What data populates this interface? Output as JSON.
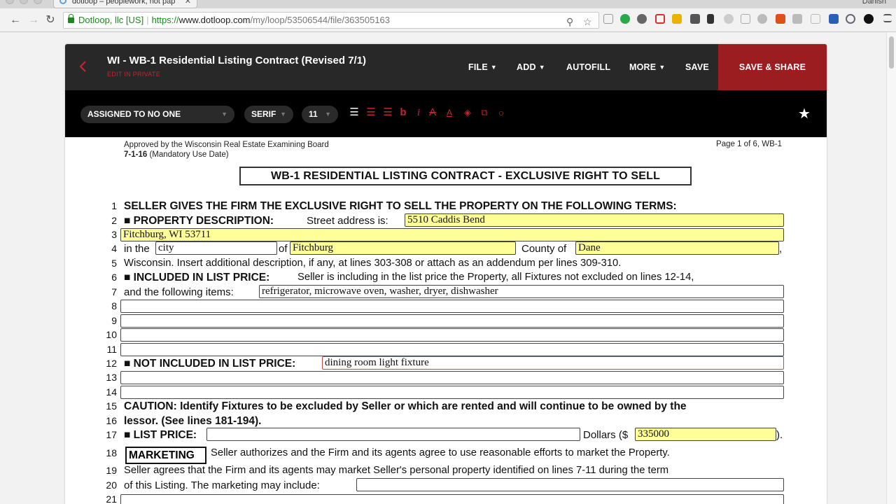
{
  "browser": {
    "tab_title": "dotloop – peoplework, not pap",
    "profile_name": "Danish",
    "secure_label": "Dotloop, llc [US]",
    "url_scheme": "https://",
    "url_domain": "www.dotloop.com",
    "url_path": "/my/loop/53506544/file/363505163"
  },
  "app": {
    "document_title": "WI - WB-1 Residential Listing Contract (Revised 7/1)",
    "subtitle": "EDIT IN PRIVATE",
    "menu": {
      "file": "FILE",
      "add": "ADD",
      "autofill": "AUTOFILL",
      "more": "MORE",
      "save": "SAVE",
      "save_share": "SAVE & SHARE"
    },
    "format": {
      "assigned": "ASSIGNED TO NO ONE",
      "font": "SERIF",
      "size": "11"
    },
    "colors": {
      "header_bg": "#282828",
      "accent_red": "#9b1d20",
      "field_yellow": "#ffff99"
    }
  },
  "doc": {
    "approved_line1": "Approved by the Wisconsin Real Estate Examining Board",
    "approved_date": "7-1-16",
    "approved_note": " (Mandatory Use Date)",
    "page_label": "Page 1 of 6, WB-1",
    "form_title": "WB-1 RESIDENTIAL LISTING CONTRACT - EXCLUSIVE RIGHT TO SELL",
    "line_numbers": [
      "1",
      "2",
      "3",
      "4",
      "5",
      "6",
      "7",
      "8",
      "9",
      "10",
      "11",
      "12",
      "13",
      "14",
      "15",
      "16",
      "17",
      "18",
      "19",
      "20",
      "21"
    ],
    "l1": "SELLER GIVES THE FIRM THE EXCLUSIVE RIGHT TO SELL THE PROPERTY ON THE FOLLOWING TERMS:",
    "l2_bold": "■ PROPERTY DESCRIPTION:",
    "l2_text": "Street address is:",
    "l4_in_the": "in the",
    "l4_of": "of",
    "l4_county": "County of",
    "l4_end": ",",
    "l5": "Wisconsin. Insert additional description, if any, at lines 303-308 or attach as an addendum per lines 309-310.",
    "l6_bold": "■ INCLUDED IN LIST PRICE:",
    "l6_text": "Seller is including in the list price the Property, all Fixtures not excluded on lines 12-14,",
    "l7": "and the following items:",
    "l12_bold": "■ NOT INCLUDED IN LIST PRICE:",
    "l15": "CAUTION: Identify Fixtures to be excluded by Seller or which are rented and will continue to be owned by the",
    "l16": "lessor. (See lines 181-194).",
    "l17_bold": "■ LIST PRICE:",
    "l17_dollars": "Dollars ($",
    "l17_end": ").",
    "l18_box": "MARKETING",
    "l18_text": "Seller authorizes and the Firm and its agents agree to use reasonable efforts to market the Property.",
    "l19": "Seller agrees that the Firm and its agents may market Seller's personal property identified on lines 7-11 during the term",
    "l20": "of this Listing. The marketing may include:"
  },
  "fields": {
    "street_address": "5510 Caddis Bend",
    "line3": "Fitchburg, WI 53711",
    "municipality_type": "city",
    "municipality": "Fitchburg",
    "county": "Dane",
    "included_items": "refrigerator, microwave oven, washer, dryer, dishwasher",
    "not_included": "dining room light fixture",
    "list_price_words": "",
    "list_price": "335000",
    "marketing": ""
  }
}
